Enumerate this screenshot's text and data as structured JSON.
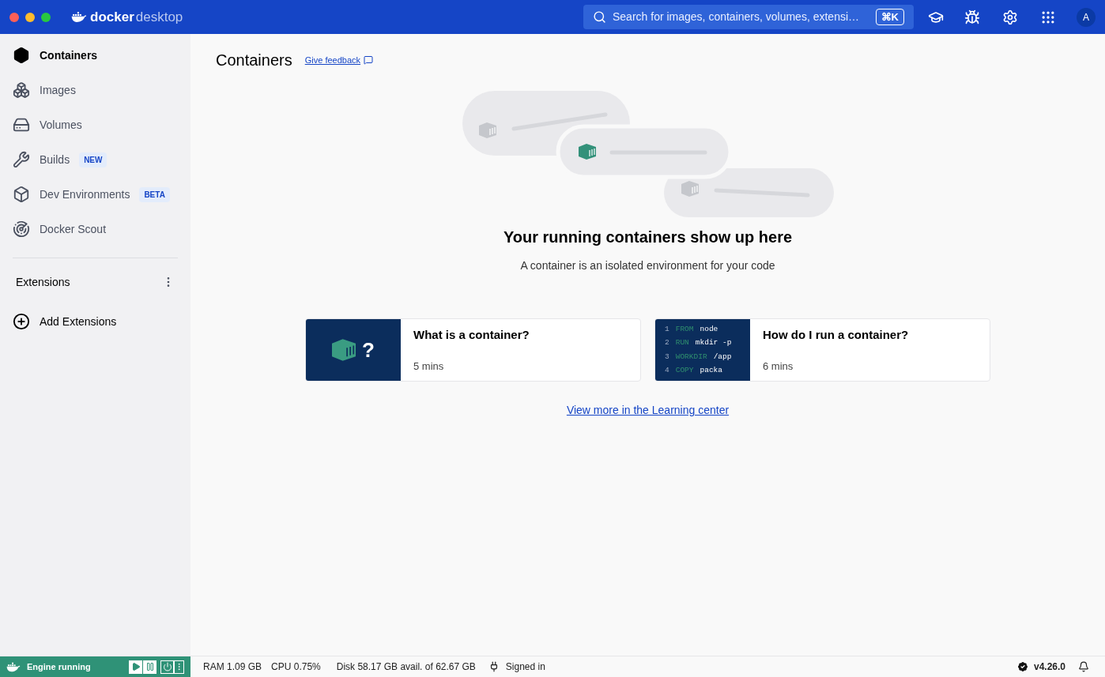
{
  "titlebar": {
    "logo_word": "docker",
    "logo_suffix": "desktop",
    "search": {
      "placeholder": "Search for images, containers, volumes, extensi…",
      "shortcut": "⌘K"
    },
    "avatar": "A"
  },
  "sidebar": {
    "items": [
      {
        "label": "Containers",
        "selected": true
      },
      {
        "label": "Images",
        "selected": false
      },
      {
        "label": "Volumes",
        "selected": false
      },
      {
        "label": "Builds",
        "selected": false,
        "badge": "NEW"
      },
      {
        "label": "Dev Environments",
        "selected": false,
        "badge": "BETA"
      },
      {
        "label": "Docker Scout",
        "selected": false
      }
    ],
    "extensions_label": "Extensions",
    "add_extensions": "Add Extensions"
  },
  "main": {
    "title": "Containers",
    "feedback_link": "Give feedback",
    "empty_title": "Your running containers show up here",
    "empty_subtitle": "A container is an isolated environment for your code",
    "cards": [
      {
        "kind": "icon",
        "thumb_text": "?",
        "title": "What is a container?",
        "duration": "5 mins"
      },
      {
        "kind": "code",
        "code": [
          {
            "num": "1",
            "keyword": "FROM",
            "rest": "node"
          },
          {
            "num": "2",
            "keyword": "RUN",
            "rest": "mkdir -p"
          },
          {
            "num": "3",
            "keyword": "WORKDIR",
            "rest": "/app"
          },
          {
            "num": "4",
            "keyword": "COPY",
            "rest": "packa"
          }
        ],
        "title": "How do I run a container?",
        "duration": "6 mins"
      }
    ],
    "learning_link": "View more in the Learning center"
  },
  "status_bar": {
    "engine": "Engine running",
    "ram": "RAM 1.09 GB",
    "cpu": "CPU 0.75%",
    "disk": "Disk 58.17 GB avail. of 62.67 GB",
    "signed": "Signed in",
    "version": "v4.26.0"
  }
}
